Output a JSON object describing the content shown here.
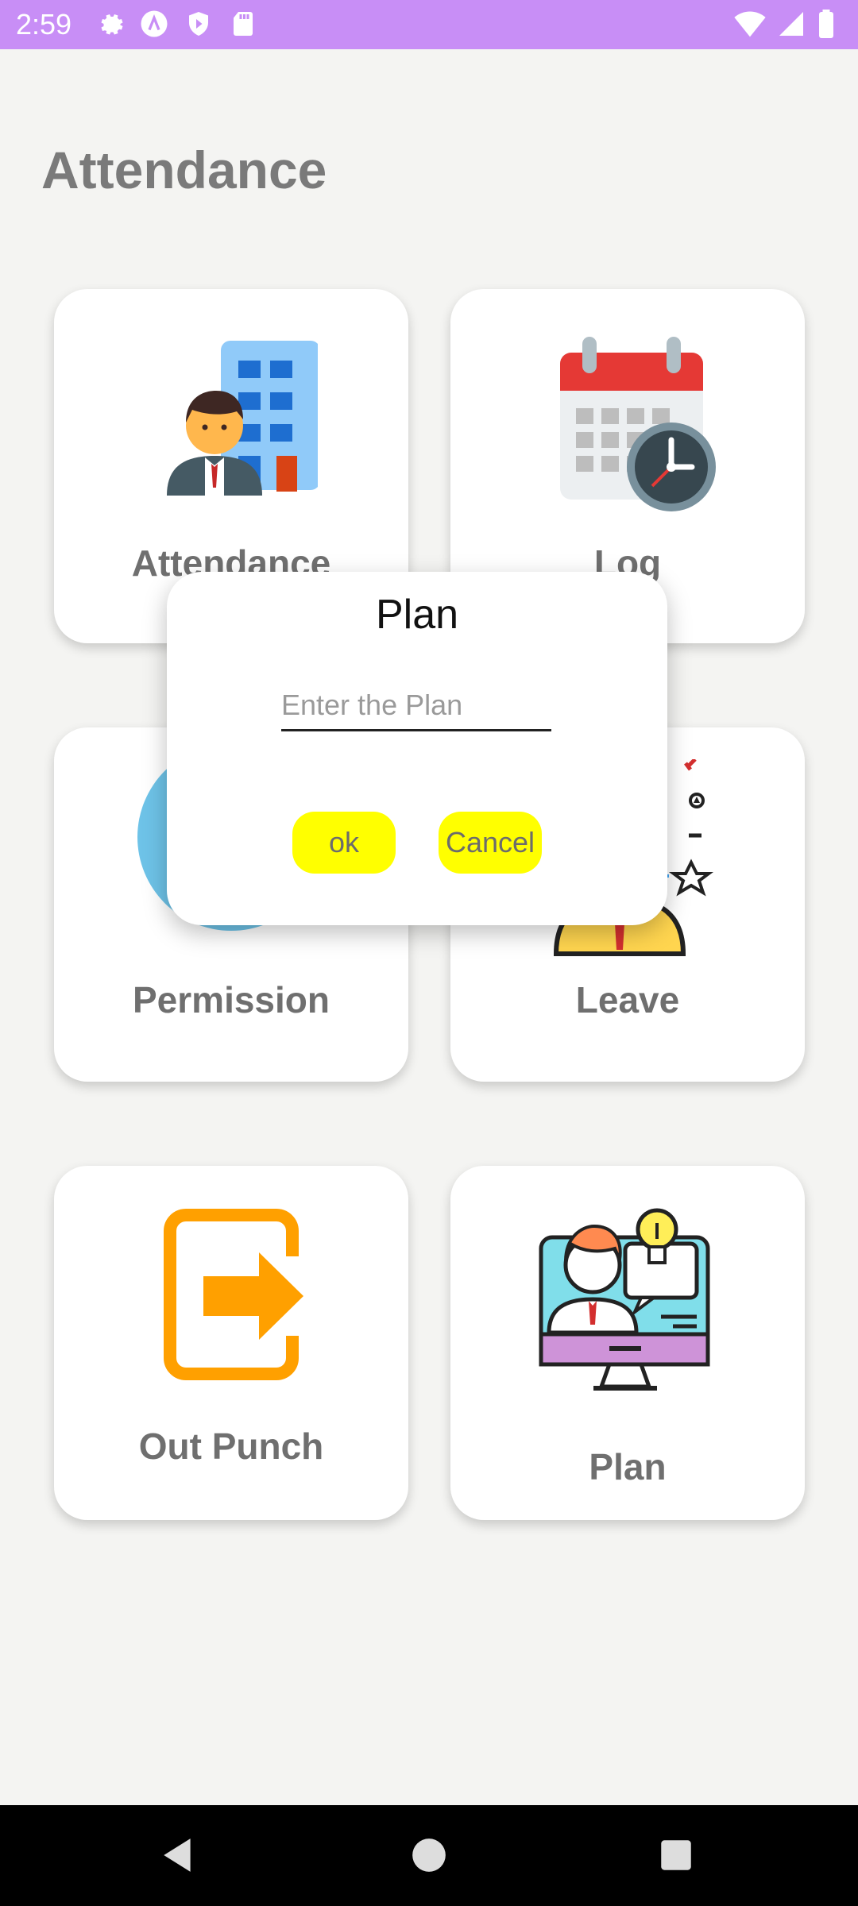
{
  "status_bar": {
    "time": "2:59"
  },
  "page": {
    "title": "Attendance"
  },
  "cards": {
    "attendance": {
      "label": "Attendance"
    },
    "log": {
      "label": "Log"
    },
    "permission": {
      "label": "Permission"
    },
    "leave": {
      "label": "Leave"
    },
    "out_punch": {
      "label": "Out Punch"
    },
    "plan": {
      "label": "Plan"
    }
  },
  "dialog": {
    "title": "Plan",
    "input_placeholder": "Enter the Plan",
    "ok_label": "ok",
    "cancel_label": "Cancel",
    "button_color": "#ffff00"
  },
  "colors": {
    "status_bar": "#c88ef6",
    "background": "#f4f4f2"
  }
}
